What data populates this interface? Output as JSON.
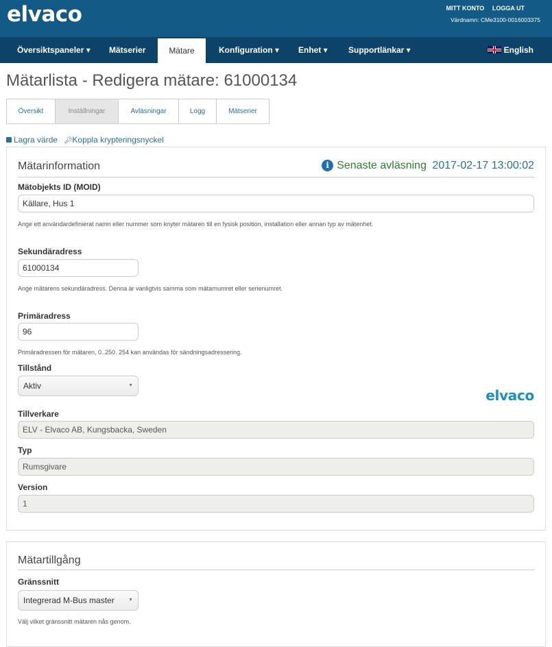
{
  "header": {
    "logo": "elvaco",
    "my_account": "MITT KONTO",
    "logout": "LOGGA UT",
    "hostname": "Värdnamn: CMe3100-0016003375"
  },
  "nav": {
    "items": [
      {
        "label": "Översiktspaneler ▾"
      },
      {
        "label": "Mätserier"
      },
      {
        "label": "Mätare"
      },
      {
        "label": "Konfiguration ▾"
      },
      {
        "label": "Enhet ▾"
      },
      {
        "label": "Supportlänkar ▾"
      }
    ],
    "active_index": 2,
    "language": "English"
  },
  "page": {
    "title": "Mätarlista - Redigera mätare: 61000134"
  },
  "tabs": [
    {
      "label": "Översikt"
    },
    {
      "label": "Inställningar"
    },
    {
      "label": "Avläsningar"
    },
    {
      "label": "Logg"
    },
    {
      "label": "Mätserier"
    }
  ],
  "active_tab": 1,
  "actions": {
    "save": "Lagra värde",
    "link_key": "Koppla krypteringsnyckel"
  },
  "meter_info": {
    "title": "Mätarinformation",
    "latest_reading_label": "Senaste avläsning",
    "latest_reading_date": "2017-02-17 13:00:02",
    "moid_label": "Mätobjekts ID (MOID)",
    "moid_value": "Källare, Hus 1",
    "moid_help": "Ange ett användardefinierat namn eller nummer som knyter mätaren till en fysisk position, installation eller annan typ av mätenhet.",
    "secondary_label": "Sekundäradress",
    "secondary_value": "61000134",
    "secondary_help": "Ange mätarens sekundäradress. Denna är vanligtvis samma som mätarnumret eller serienumret.",
    "primary_label": "Primäradress",
    "primary_value": "96",
    "primary_help": "Primäradressen för mätaren, 0..250. 254 kan användas för sändningsadressering.",
    "state_label": "Tillstånd",
    "state_value": "Aktiv",
    "manufacturer_logo": "elvaco",
    "manufacturer_label": "Tillverkare",
    "manufacturer_value": "ELV - Elvaco AB, Kungsbacka, Sweden",
    "type_label": "Typ",
    "type_value": "Rumsgivare",
    "version_label": "Version",
    "version_value": "1"
  },
  "meter_access": {
    "title": "Mätartillgång",
    "interface_label": "Gränssnitt",
    "interface_value": "Integrerad M-Bus master",
    "interface_help": "Välj vilket gränssnitt mätaren nås genom."
  },
  "colors": {
    "header_bg": "#135b86",
    "nav_bg": "#0d4369",
    "link": "#2a6f97",
    "status_green": "#2e7d32"
  }
}
